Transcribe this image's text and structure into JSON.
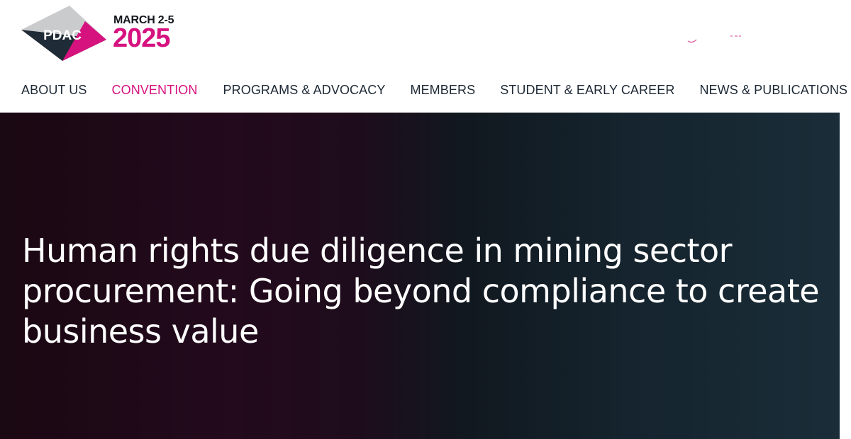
{
  "brand": {
    "logo_text": "PDAC",
    "event_dates": "MARCH 2-5",
    "event_year": "2025",
    "colors": {
      "accent": "#d6127f",
      "dark": "#1e2a36",
      "logo_gray": "#c9cbcd"
    }
  },
  "nav": {
    "items": [
      {
        "label": "ABOUT US"
      },
      {
        "label": "CONVENTION"
      },
      {
        "label": "PROGRAMS & ADVOCACY"
      },
      {
        "label": "MEMBERS"
      },
      {
        "label": "STUDENT & EARLY CAREER"
      },
      {
        "label": "NEWS & PUBLICATIONS"
      }
    ],
    "active": "CONVENTION"
  },
  "hero": {
    "title": "Human rights due diligence in mining sector procurement: Going beyond compliance to create business value"
  }
}
